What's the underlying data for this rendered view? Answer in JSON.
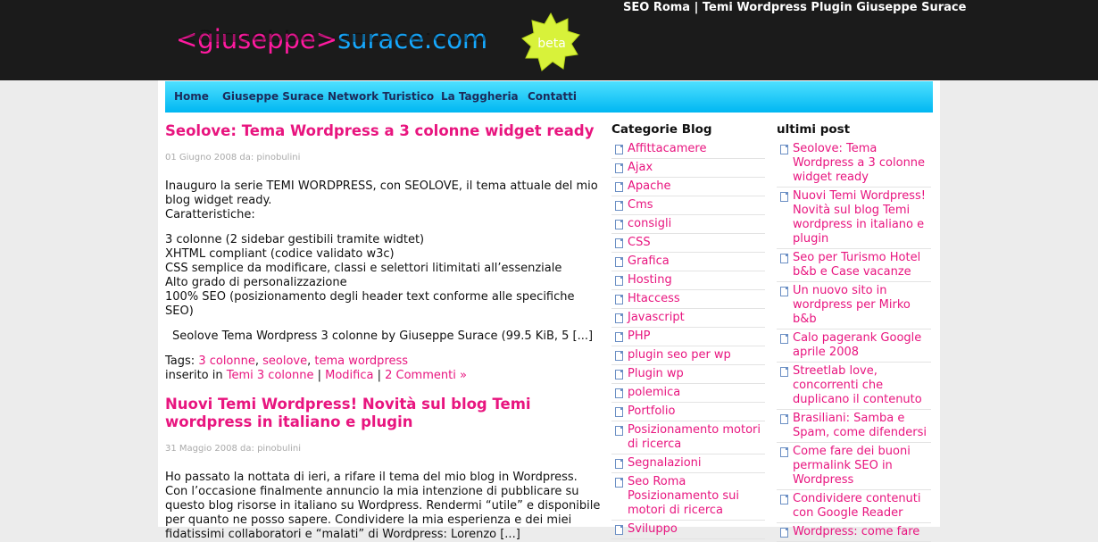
{
  "header": {
    "top_links": "SEO Roma | Temi Wordpress Plugin Giuseppe Surace",
    "logo_part1": "<giuseppe>",
    "logo_part2": "surace.com",
    "badge": "beta"
  },
  "nav": [
    "Home",
    "Giuseppe Surace",
    "Network Turistico",
    "La Taggheria",
    "Contatti"
  ],
  "posts": [
    {
      "title": "Seolove: Tema Wordpress a 3 colonne widget ready",
      "meta": "01 Giugno 2008 da: pinobulini",
      "intro": [
        "Inauguro la serie TEMI WORDPRESS, con SEOLOVE, il tema attuale del mio blog widget ready.",
        "Caratteristiche:"
      ],
      "features": [
        "3 colonne (2 sidebar gestibili tramite widtet)",
        "XHTML compliant (codice validato w3c)",
        "CSS semplice da modificare, classi e selettori litimitati all’essenziale",
        "Alto grado di personalizzazione",
        "100% SEO (posizionamento degli header text conforme alle specifiche SEO)"
      ],
      "download": "Seolove Tema Wordpress 3 colonne by Giuseppe Surace (99.5 KiB, 5 [...]",
      "tags_label": "Tags:",
      "tags": [
        "3 colonne",
        "seolove",
        "tema wordpress"
      ],
      "posted_label": "inserito in",
      "category": "Temi 3 colonne",
      "edit": "Modifica",
      "comments": "2 Commenti »"
    },
    {
      "title": "Nuovi Temi Wordpress! Novità sul blog Temi wordpress in italiano e plugin",
      "meta": "31 Maggio 2008 da: pinobulini",
      "body": "Ho passato la nottata di ieri, a rifare il tema del mio blog in Wordpress. Con l’occasione finalmente annuncio la mia intenzione di pubblicare su questo blog risorse in italiano su Wordpress. Rendermi “utile” e disponibile per quanto ne posso sapere. Condividere la mia esperienza e dei miei fidatissimi collaboratori e “malati” di Wordpress: Lorenzo [...]"
    }
  ],
  "categories": {
    "title": "Categorie Blog",
    "items": [
      "Affittacamere",
      "Ajax",
      "Apache",
      "Cms",
      "consigli",
      "CSS",
      "Grafica",
      "Hosting",
      "Htaccess",
      "Javascript",
      "PHP",
      "plugin seo per wp",
      "Plugin wp",
      "polemica",
      "Portfolio",
      "Posizionamento motori di ricerca",
      "Segnalazioni",
      "Seo Roma Posizionamento sui motori di ricerca",
      "Sviluppo"
    ]
  },
  "recent": {
    "title": "ultimi post",
    "items": [
      "Seolove: Tema Wordpress a 3 colonne widget ready",
      "Nuovi Temi Wordpress! Novità sul blog Temi wordpress in italiano e plugin",
      "Seo per Turismo Hotel b&b e Case vacanze",
      "Un nuovo sito in wordpress per Mirko b&b",
      "Calo pagerank Google aprile 2008",
      "Streetlab love, concorrenti che duplicano il contenuto",
      "Brasiliani: Samba e Spam, come difendersi",
      "Come fare dei buoni permalink SEO in Wordpress",
      "Condividere contenuti con Google Reader",
      "Wordpress: come fare"
    ]
  },
  "colors": {
    "accent": "#e8157f",
    "nav_top": "#4fe0ff",
    "nav_bottom": "#00b7f2",
    "header_bg": "#1b1b1b"
  }
}
